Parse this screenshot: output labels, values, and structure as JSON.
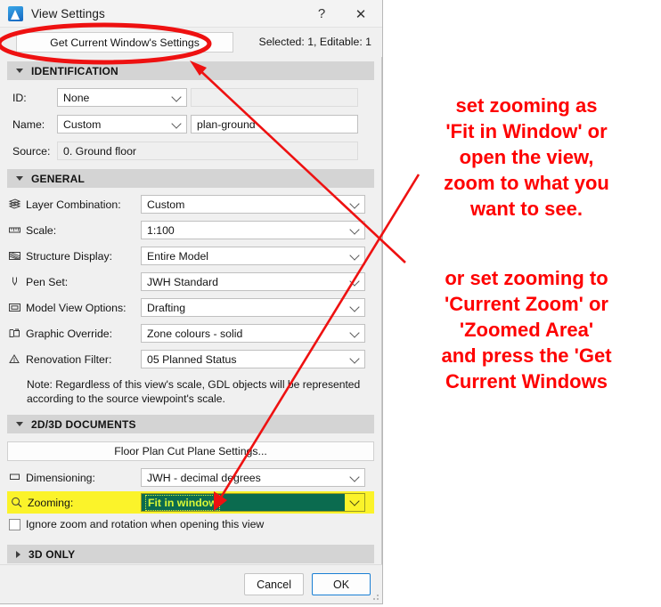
{
  "window": {
    "title": "View Settings",
    "app_icon": "archicad-icon",
    "help_label": "?",
    "close_label": "✕"
  },
  "topbar": {
    "get_current_label": "Get Current Window's Settings",
    "selected_info": "Selected: 1, Editable: 1"
  },
  "sections": {
    "identification": {
      "header": "IDENTIFICATION",
      "expanded": true,
      "rows": [
        {
          "label": "ID:",
          "combo_value": "None",
          "text_value": ""
        },
        {
          "label": "Name:",
          "combo_value": "Custom",
          "text_value": "plan-ground"
        },
        {
          "label": "Source:",
          "value": "0. Ground floor"
        }
      ]
    },
    "general": {
      "header": "GENERAL",
      "expanded": true,
      "rows": [
        {
          "icon": "layers-icon",
          "label": "Layer Combination:",
          "value": "Custom"
        },
        {
          "icon": "ruler-icon",
          "label": "Scale:",
          "value": "1:100"
        },
        {
          "icon": "structure-icon",
          "label": "Structure Display:",
          "value": "Entire Model"
        },
        {
          "icon": "pen-icon",
          "label": "Pen Set:",
          "value": "JWH Standard"
        },
        {
          "icon": "model-view-icon",
          "label": "Model View Options:",
          "value": "Drafting"
        },
        {
          "icon": "graphic-override-icon",
          "label": "Graphic Override:",
          "value": "Zone colours - solid"
        },
        {
          "icon": "renovation-icon",
          "label": "Renovation Filter:",
          "value": "05 Planned Status"
        }
      ],
      "note": "Note: Regardless of this view's scale, GDL objects will be represented according to the source viewpoint's scale."
    },
    "documents_2d3d": {
      "header": "2D/3D DOCUMENTS",
      "expanded": true,
      "cut_plane_button": "Floor Plan Cut Plane Settings...",
      "dimensioning": {
        "icon": "dimension-icon",
        "label": "Dimensioning:",
        "value": "JWH - decimal degrees"
      },
      "zooming": {
        "icon": "magnifier-icon",
        "label": "Zooming:",
        "value": "Fit in window",
        "highlight_color": "#fbf32a",
        "select_bg": "#0b6b4f",
        "select_fg": "#d8f736"
      },
      "ignore_zoom_checkbox": {
        "label": "Ignore zoom and rotation when opening this view",
        "checked": false
      }
    },
    "three_d_only": {
      "header": "3D ONLY",
      "expanded": false
    }
  },
  "footer": {
    "cancel_label": "Cancel",
    "ok_label": "OK"
  },
  "annotations": {
    "color": "#fe0000",
    "note_1": "set zooming as\n'Fit in Window' or\nopen the view,\nzoom to what you\nwant to see.",
    "note_2": "or set zooming to\n'Current Zoom' or\n'Zoomed Area'\nand press the 'Get\nCurrent Windows",
    "ellipse_target": "get-current-window-settings-button"
  }
}
